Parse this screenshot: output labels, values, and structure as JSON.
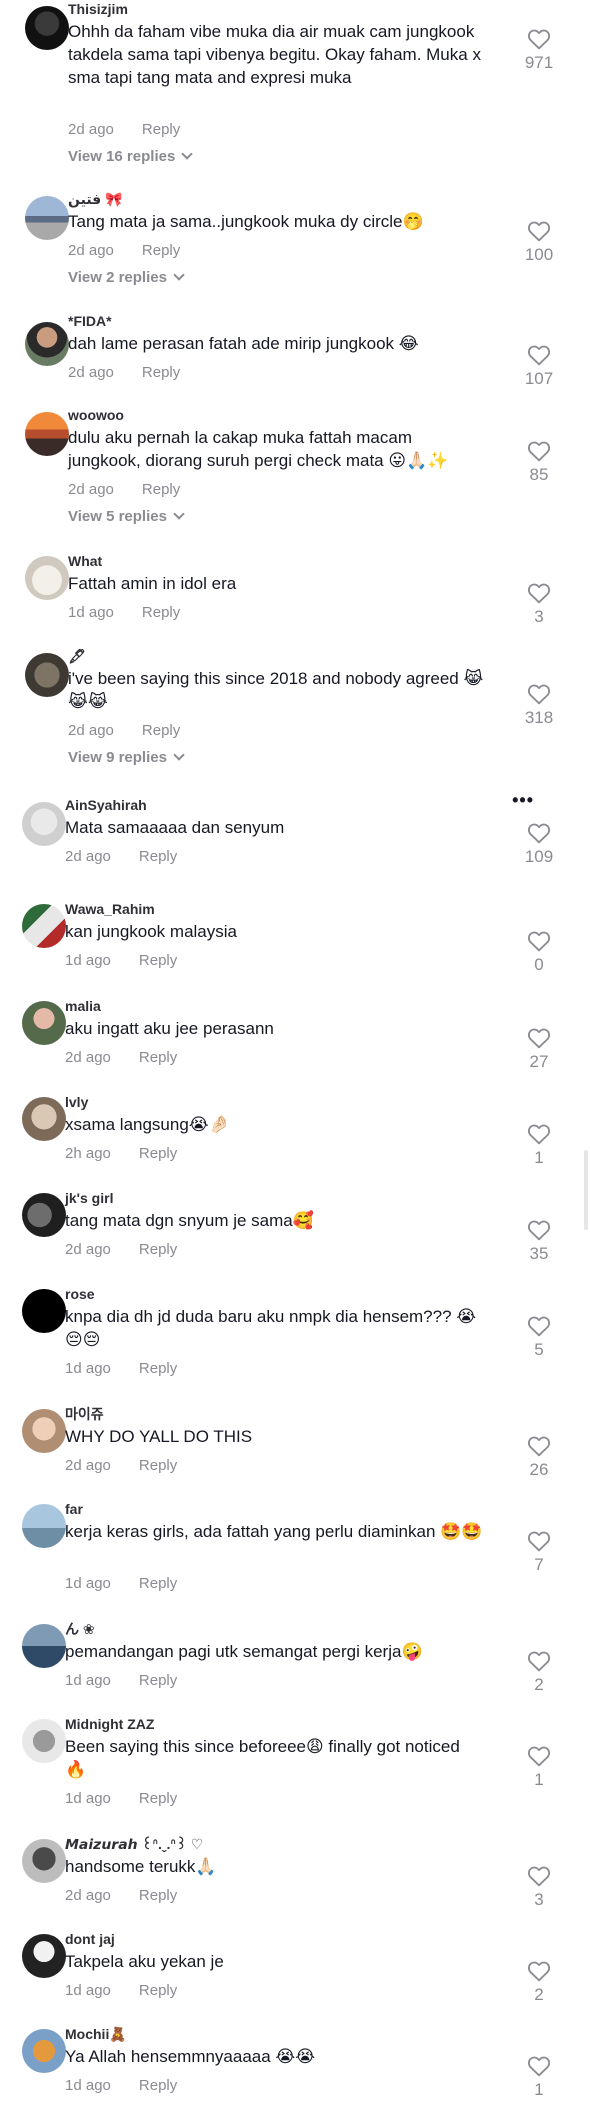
{
  "colors": {
    "text": "#161823",
    "muted": "#8a8b91",
    "background": "#ffffff"
  },
  "icons": {
    "like": "heart-outline-icon",
    "expand": "chevron-down-icon",
    "options": "more-dots-icon"
  },
  "comments": [
    {
      "username": "Thisizjim",
      "text": "Ohhh da faham vibe muka dia air muak cam jungkook takdela sama tapi vibenya begitu. Okay faham. Muka x sma tapi tang mata and expresi muka",
      "time": "2d ago",
      "reply_label": "Reply",
      "likes": "971",
      "view_replies": "View 16 replies"
    },
    {
      "username": "فتين 🎀",
      "text": "Tang mata ja sama..jungkook muka dy circle🤭",
      "time": "2d ago",
      "reply_label": "Reply",
      "likes": "100",
      "view_replies": "View 2 replies"
    },
    {
      "username": "*FIDA*",
      "text": "dah lame perasan fatah ade mirip jungkook 😂",
      "time": "2d ago",
      "reply_label": "Reply",
      "likes": "107"
    },
    {
      "username": "woowoo",
      "text": "dulu aku pernah la cakap muka fattah macam jungkook, diorang suruh pergi check mata 😛🙏🏻✨",
      "time": "2d ago",
      "reply_label": "Reply",
      "likes": "85",
      "view_replies": "View 5 replies"
    },
    {
      "username": "What",
      "text": "Fattah amin in idol era",
      "time": "1d ago",
      "reply_label": "Reply",
      "likes": "3"
    },
    {
      "username": "🖋",
      "text": "i've been saying this since 2018 and nobody agreed 😹😹😹",
      "time": "2d ago",
      "reply_label": "Reply",
      "likes": "318",
      "view_replies": "View 9 replies"
    },
    {
      "username": "AinSyahirah",
      "text": "Mata samaaaaa dan senyum",
      "time": "2d ago",
      "reply_label": "Reply",
      "likes": "109",
      "more_label": "•••"
    },
    {
      "username": "Wawa_Rahim",
      "text": "kan jungkook malaysia",
      "time": "1d ago",
      "reply_label": "Reply",
      "likes": "0"
    },
    {
      "username": "malia",
      "text": "aku ingatt aku jee perasann",
      "time": "2d ago",
      "reply_label": "Reply",
      "likes": "27"
    },
    {
      "username": "lvly",
      "text": "xsama langsung😭🤌🏻",
      "time": "2h ago",
      "reply_label": "Reply",
      "likes": "1"
    },
    {
      "username": "jk's girl",
      "text": "tang mata dgn snyum je sama🥰",
      "time": "2d ago",
      "reply_label": "Reply",
      "likes": "35"
    },
    {
      "username": "rose",
      "text": "knpa dia dh jd duda baru aku nmpk dia hensem??? 😭😔😔",
      "time": "1d ago",
      "reply_label": "Reply",
      "likes": "5"
    },
    {
      "username": "마이쥬",
      "text": "WHY DO YALL DO THIS",
      "time": "2d ago",
      "reply_label": "Reply",
      "likes": "26"
    },
    {
      "username": "far",
      "text": "kerja keras girls, ada fattah yang perlu diaminkan 🤩🤩",
      "time": "1d ago",
      "reply_label": "Reply",
      "likes": "7"
    },
    {
      "username": "ん ❀",
      "text": "pemandangan pagi utk semangat pergi kerja🤪",
      "time": "1d ago",
      "reply_label": "Reply",
      "likes": "2"
    },
    {
      "username": "Midnight ZAZ",
      "text": "Been saying this since beforeee😩 finally got noticed 🔥",
      "time": "1d ago",
      "reply_label": "Reply",
      "likes": "1"
    },
    {
      "username": "𝙈𝙖𝙞𝙯𝙪𝙧𝙖𝙝 ꒰ᐢ.ˬ.ᐢ꒱ ♡",
      "text": "handsome terukk🙏🏻",
      "time": "2d ago",
      "reply_label": "Reply",
      "likes": "3"
    },
    {
      "username": "dont jaj",
      "text": "Takpela aku yekan je",
      "time": "1d ago",
      "reply_label": "Reply",
      "likes": "2"
    },
    {
      "username": "Mochii🧸",
      "text": "Ya Allah hensemmnyaaaaa 😭😭",
      "time": "1d ago",
      "reply_label": "Reply",
      "likes": "1"
    }
  ]
}
